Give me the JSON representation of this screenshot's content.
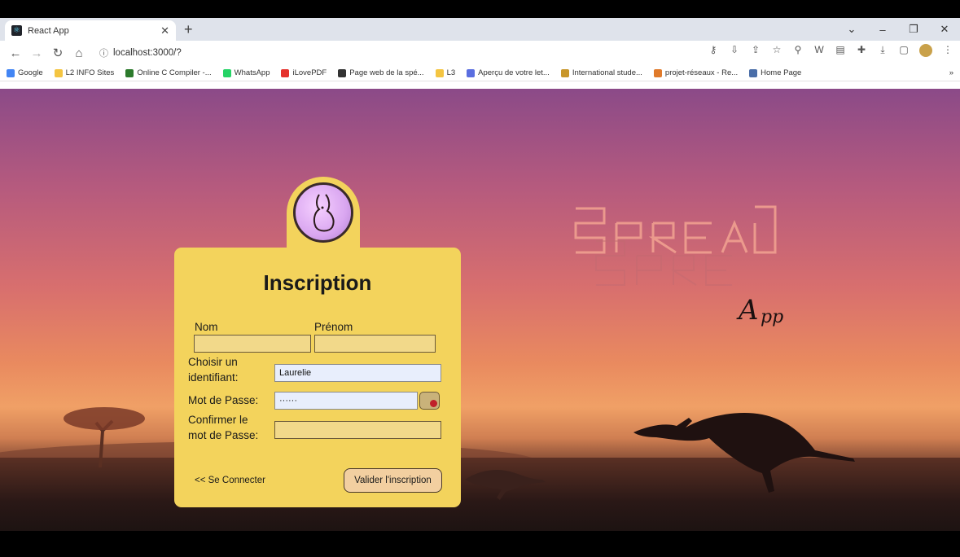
{
  "browser": {
    "tab_title": "React App",
    "url": "localhost:3000/?",
    "bookmarks": [
      {
        "label": "Google",
        "color": "#4285f4"
      },
      {
        "label": "L2 INFO Sites",
        "color": "#f4c542"
      },
      {
        "label": "Online C Compiler -...",
        "color": "#2c7a2c"
      },
      {
        "label": "WhatsApp",
        "color": "#25d366"
      },
      {
        "label": "iLovePDF",
        "color": "#e5322d"
      },
      {
        "label": "Page web de la spé...",
        "color": "#333333"
      },
      {
        "label": "L3",
        "color": "#f4c542"
      },
      {
        "label": "Aperçu de votre let...",
        "color": "#5a6ee0"
      },
      {
        "label": "International stude...",
        "color": "#c8962a"
      },
      {
        "label": "projet-réseaux - Re...",
        "color": "#e07a2a"
      },
      {
        "label": "Home Page",
        "color": "#4a6ea8"
      }
    ],
    "bookmarks_more": "»"
  },
  "form": {
    "title": "Inscription",
    "nom_label": "Nom",
    "prenom_label": "Prénom",
    "nom_value": "",
    "prenom_value": "",
    "identifiant_label_1": "Choisir un",
    "identifiant_label_2": "identifiant:",
    "identifiant_value": "Laurelie",
    "password_label": "Mot de Passe:",
    "password_value": "······",
    "confirm_label_1": "Confirmer le",
    "confirm_label_2": "mot de Passe:",
    "confirm_value": "",
    "login_link": "<< Se Connecter",
    "submit_label": "Valider l'inscription"
  },
  "colors": {
    "card": "#f3d35c",
    "input": "#f2d98a",
    "button": "#f2cfa0"
  }
}
